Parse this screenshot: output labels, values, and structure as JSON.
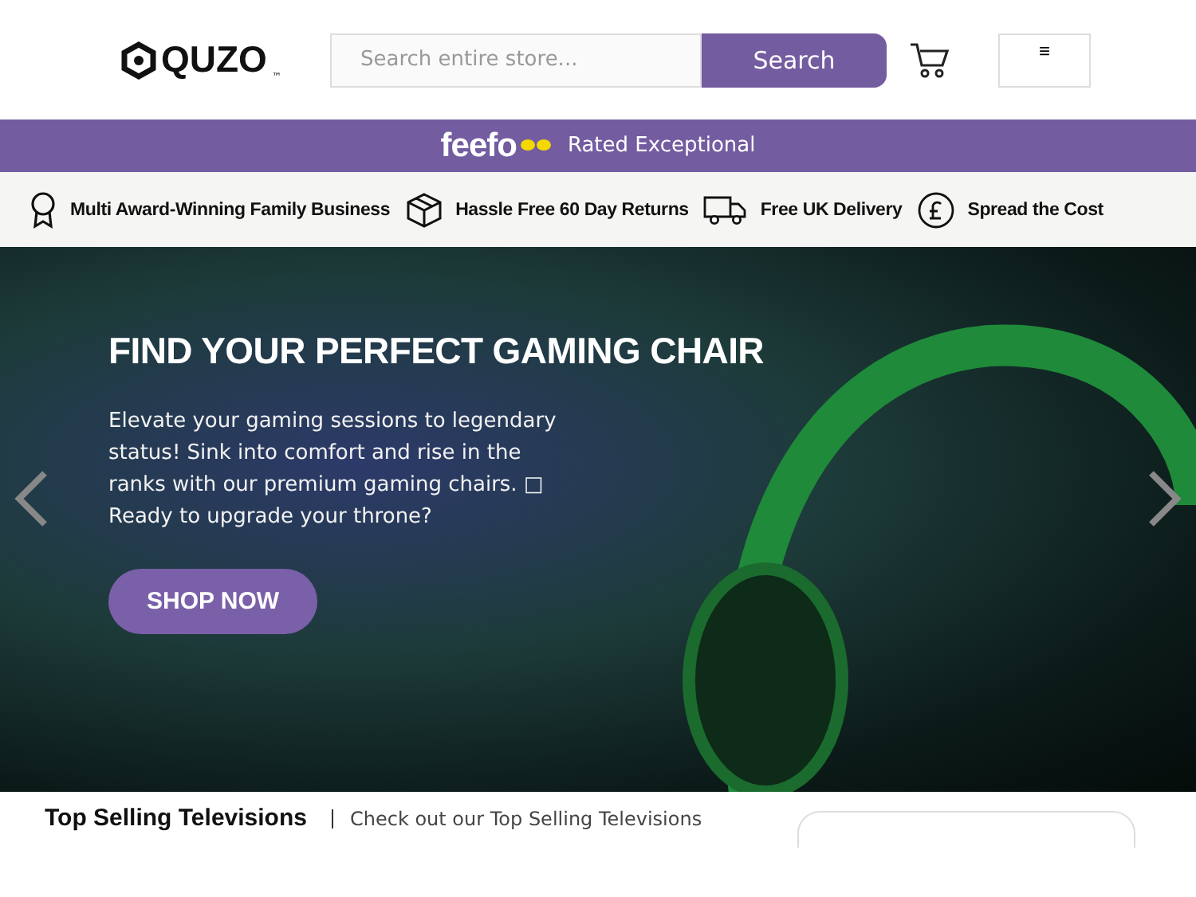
{
  "header": {
    "logo": "QUZO",
    "logo_mark": "™",
    "search": {
      "placeholder": "Search entire store...",
      "button": "Search"
    },
    "menu_button": "≡"
  },
  "rating_bar": {
    "brand": "feefo",
    "text": "Rated Exceptional"
  },
  "usps": [
    {
      "kind": "award",
      "text": "Multi Award-Winning Family Business"
    },
    {
      "kind": "returns",
      "text": "Hassle Free 60 Day Returns"
    },
    {
      "kind": "delivery",
      "text": "Free UK Delivery"
    },
    {
      "kind": "finance",
      "text": "Spread the Cost"
    }
  ],
  "hero": {
    "title": "FIND YOUR PERFECT GAMING CHAIR",
    "body": "Elevate your gaming sessions to legendary status! Sink into comfort and rise in the ranks with our premium gaming chairs. □ Ready to upgrade your throne?",
    "button": "SHOP NOW"
  },
  "section": {
    "title": "Top Selling Televisions",
    "subtitle": "Check out our Top Selling Televisions"
  }
}
